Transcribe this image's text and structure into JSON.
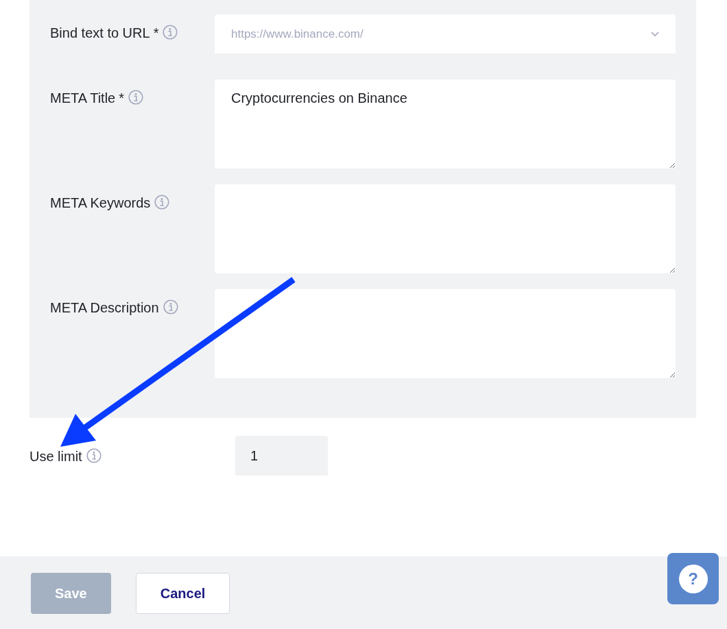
{
  "form_fields": [
    {
      "kind": "select",
      "label": "Bind text to URL",
      "required_mark": "*",
      "placeholder": "https://www.binance.com/"
    },
    {
      "kind": "textarea",
      "label": "META Title",
      "required_mark": "*",
      "value": "Cryptocurrencies on Binance"
    },
    {
      "kind": "textarea",
      "label": "META Keywords"
    },
    {
      "kind": "textarea",
      "label": "META Description"
    }
  ],
  "use_limit": {
    "label": "Use limit",
    "value": "1"
  },
  "footer": {
    "buttons": [
      {
        "label": "Save",
        "kind": "primary",
        "disabled": true
      },
      {
        "label": "Cancel",
        "kind": "secondary",
        "disabled": false
      }
    ],
    "help": "?"
  }
}
